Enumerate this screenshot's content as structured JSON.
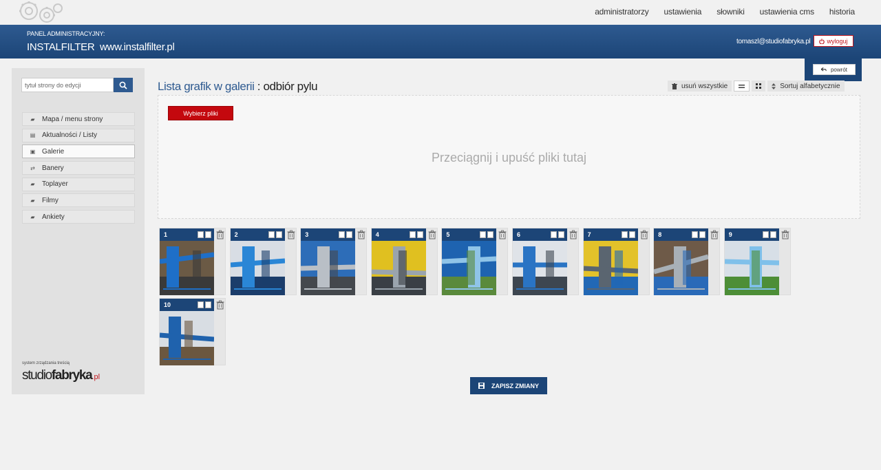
{
  "topnav": [
    "administratorzy",
    "ustawienia",
    "słowniki",
    "ustawienia cms",
    "historia"
  ],
  "header": {
    "panel_label": "PANEL ADMINISTRACYJNY:",
    "site_name": "INSTALFILTER",
    "site_url": "www.instalfilter.pl",
    "user_email": "tomaszl@studiofabryka.pl",
    "logout_label": "wyloguj",
    "back_label": "powrót"
  },
  "sidebar": {
    "search_placeholder": "tytuł strony do edycji",
    "items": [
      {
        "label": "Mapa / menu strony",
        "icon": "folder-icon",
        "active": false
      },
      {
        "label": "Aktualności / Listy",
        "icon": "list-icon",
        "active": false
      },
      {
        "label": "Galerie",
        "icon": "image-icon",
        "active": true
      },
      {
        "label": "Banery",
        "icon": "banner-icon",
        "active": false
      },
      {
        "label": "Toplayer",
        "icon": "folder-icon",
        "active": false
      },
      {
        "label": "Filmy",
        "icon": "folder-icon",
        "active": false
      },
      {
        "label": "Ankiety",
        "icon": "folder-icon",
        "active": false
      }
    ],
    "cms_note": "system zrządzania treścią",
    "brand_part1": "studio",
    "brand_part2": "fabryka",
    "brand_part3": ".pl"
  },
  "main": {
    "title_prefix": "Lista grafik w galerii",
    "title_separator": " : ",
    "title_name": "odbiór pylu",
    "toolbar": {
      "delete_all": "usuń wszystkie",
      "sort": "Sortuj alfabetycznie"
    },
    "upload": {
      "choose_label": "Wybierz pliki",
      "drop_text": "Przeciągnij i upuść pliki tutaj"
    },
    "images": [
      {
        "num": "1",
        "palette": [
          "#1e6fc8",
          "#6b5a45",
          "#3a3a3a"
        ]
      },
      {
        "num": "2",
        "palette": [
          "#2a86d6",
          "#d8dde4",
          "#1b3d6b"
        ]
      },
      {
        "num": "3",
        "palette": [
          "#b9bfc6",
          "#2d6db8",
          "#44484d"
        ]
      },
      {
        "num": "4",
        "palette": [
          "#9aa4ad",
          "#e0c020",
          "#3a3f45"
        ]
      },
      {
        "num": "5",
        "palette": [
          "#8fc4e8",
          "#1e63b0",
          "#5a8a3c"
        ]
      },
      {
        "num": "6",
        "palette": [
          "#2a74c4",
          "#dfe3e8",
          "#3d4650"
        ]
      },
      {
        "num": "7",
        "palette": [
          "#5a6570",
          "#e3c22a",
          "#2268b5"
        ]
      },
      {
        "num": "8",
        "palette": [
          "#a8b0b7",
          "#6e5a48",
          "#2a6ab8"
        ]
      },
      {
        "num": "9",
        "palette": [
          "#7fc0ea",
          "#d7dfe7",
          "#4d8e37"
        ]
      },
      {
        "num": "10",
        "palette": [
          "#1f62ad",
          "#d8dde3",
          "#6b5740"
        ]
      }
    ],
    "save_label": "ZAPISZ ZMIANY"
  },
  "colors": {
    "primary_blue": "#1c4577",
    "accent_red": "#c4080e",
    "background": "#f1f1f1"
  }
}
